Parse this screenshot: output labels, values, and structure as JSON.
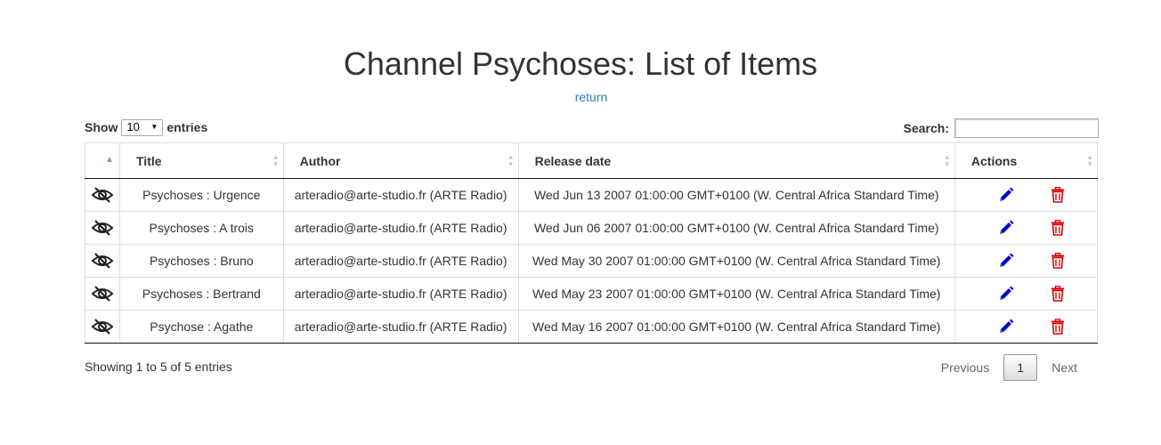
{
  "page": {
    "title": "Channel Psychoses: List of Items",
    "return_link": "return"
  },
  "controls": {
    "show_label": "Show",
    "entries_label": "entries",
    "page_length": "10",
    "search_label": "Search:",
    "search_value": ""
  },
  "table": {
    "columns": [
      "",
      "Title",
      "Author",
      "Release date",
      "Actions"
    ],
    "rows": [
      {
        "title": "Psychoses : Urgence",
        "author": "arteradio@arte-studio.fr (ARTE Radio)",
        "release": "Wed Jun 13 2007 01:00:00 GMT+0100 (W. Central Africa Standard Time)"
      },
      {
        "title": "Psychoses : A trois",
        "author": "arteradio@arte-studio.fr (ARTE Radio)",
        "release": "Wed Jun 06 2007 01:00:00 GMT+0100 (W. Central Africa Standard Time)"
      },
      {
        "title": "Psychoses : Bruno",
        "author": "arteradio@arte-studio.fr (ARTE Radio)",
        "release": "Wed May 30 2007 01:00:00 GMT+0100 (W. Central Africa Standard Time)"
      },
      {
        "title": "Psychoses : Bertrand",
        "author": "arteradio@arte-studio.fr (ARTE Radio)",
        "release": "Wed May 23 2007 01:00:00 GMT+0100 (W. Central Africa Standard Time)"
      },
      {
        "title": "Psychose : Agathe",
        "author": "arteradio@arte-studio.fr (ARTE Radio)",
        "release": "Wed May 16 2007 01:00:00 GMT+0100 (W. Central Africa Standard Time)"
      }
    ],
    "icons": {
      "visibility": "eye-slash-icon",
      "edit": "pencil-icon",
      "delete": "trash-icon"
    },
    "colors": {
      "edit": "#0000cc",
      "delete": "#e00000"
    }
  },
  "footer": {
    "info": "Showing 1 to 5 of 5 entries",
    "previous": "Previous",
    "current_page": "1",
    "next": "Next"
  }
}
